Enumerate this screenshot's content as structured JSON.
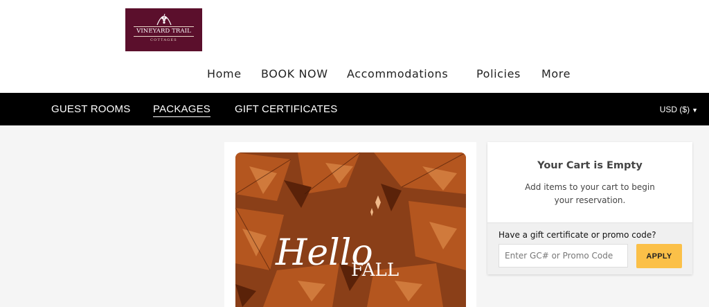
{
  "header": {
    "logo": {
      "name": "VINEYARD TRAIL",
      "sub": "COTTAGES"
    },
    "nav": [
      {
        "label": "Home"
      },
      {
        "label": "BOOK NOW"
      },
      {
        "label": "Accommodations"
      },
      {
        "label": "Policies"
      },
      {
        "label": "More"
      }
    ]
  },
  "subnav": {
    "tabs": [
      {
        "label": "GUEST ROOMS",
        "active": false
      },
      {
        "label": "PACKAGES",
        "active": true
      },
      {
        "label": "GIFT CERTIFICATES",
        "active": false
      }
    ],
    "currency": "USD ($)"
  },
  "package": {
    "image_text": {
      "script": "Hello",
      "word": "FALL"
    }
  },
  "cart": {
    "title": "Your Cart is Empty",
    "message": "Add items to your cart to begin your reservation.",
    "promo_label": "Have a gift certificate or promo code?",
    "promo_placeholder": "Enter GC# or Promo Code",
    "apply_label": "APPLY"
  },
  "colors": {
    "brand": "#5b0f2c",
    "subnav_bg": "#000000",
    "apply_button": "#fbc048",
    "page_bg": "#f5f5f5"
  }
}
